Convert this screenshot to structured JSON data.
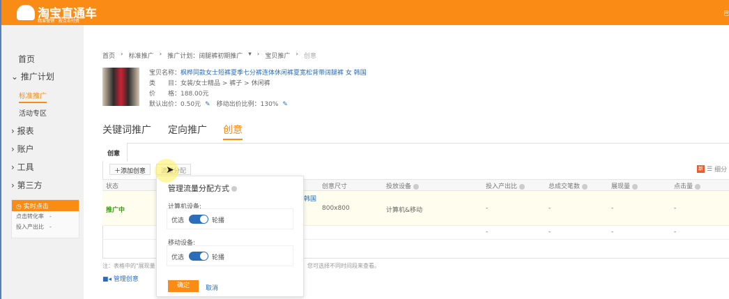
{
  "header": {
    "logo_text": "淘宝直通车",
    "logo_sub": "精准营销 · 按点击付费",
    "right_text": "巴"
  },
  "sidebar": {
    "items": [
      {
        "label": "首页"
      },
      {
        "label": "推广计划",
        "expanded": true
      },
      {
        "label": "标准推广",
        "active": true
      },
      {
        "label": "活动专区"
      },
      {
        "label": "报表"
      },
      {
        "label": "账户"
      },
      {
        "label": "工具"
      },
      {
        "label": "第三方"
      }
    ],
    "realtime": {
      "title": "实时点击",
      "rows": [
        {
          "label": "点击转化率",
          "value": "-"
        },
        {
          "label": "投入产出比",
          "value": "-"
        }
      ]
    }
  },
  "breadcrumb": [
    "首页",
    "标准推广",
    "推广计划：阔腿裤初期推广",
    "宝贝推广",
    "创意"
  ],
  "product": {
    "name_label": "宝贝名称：",
    "name": "枫桦同款女士短裤夏季七分裤连体休闲裤夏宽松背带阔腿裤 女 韩国",
    "category_label": "类　　目：",
    "category": "女装/女士精品 > 裤子 > 休闲裤",
    "price_label": "价　　格：",
    "price": "188.00元",
    "bid_label": "默认出价：",
    "bid": "0.50元",
    "mobile_label": "移动出价比例：",
    "mobile": "130%"
  },
  "main_tabs": [
    {
      "label": "关键词推广"
    },
    {
      "label": "定向推广"
    },
    {
      "label": "创意",
      "active": true
    }
  ],
  "subtab": "创意",
  "toolbar": {
    "add": "添加创意",
    "flow": "流量分配",
    "new_badge": "新",
    "split": "细分"
  },
  "table": {
    "headers": [
      "状态",
      "创意尺寸",
      "投放设备",
      "投入产出比",
      "总成交笔数",
      "展现量",
      "点击量"
    ],
    "rows": [
      {
        "status": "推广中",
        "title_tail": "韩国",
        "size": "800x800",
        "device": "计算机&移动",
        "roi": "-",
        "deals": "-",
        "impressions": "-",
        "clicks": "-"
      },
      {
        "roi": "-",
        "deals": "-",
        "impressions": "-",
        "clicks": "-"
      }
    ]
  },
  "note": {
    "left": "注：表格中的\"展现量",
    "right": "您可选择不同时间段来查看。"
  },
  "manage_link": "管理创意",
  "popup": {
    "title": "管理流量分配方式",
    "pc_label": "计算机设备:",
    "mobile_label": "移动设备:",
    "opt_left": "优选",
    "opt_right": "轮播",
    "pc_value": "轮播",
    "mobile_value": "轮播",
    "ok": "确定",
    "cancel": "取消"
  },
  "colors": {
    "brand": "#fa8c16",
    "link": "#2a6ebb",
    "status_green": "#3a9a1a"
  }
}
